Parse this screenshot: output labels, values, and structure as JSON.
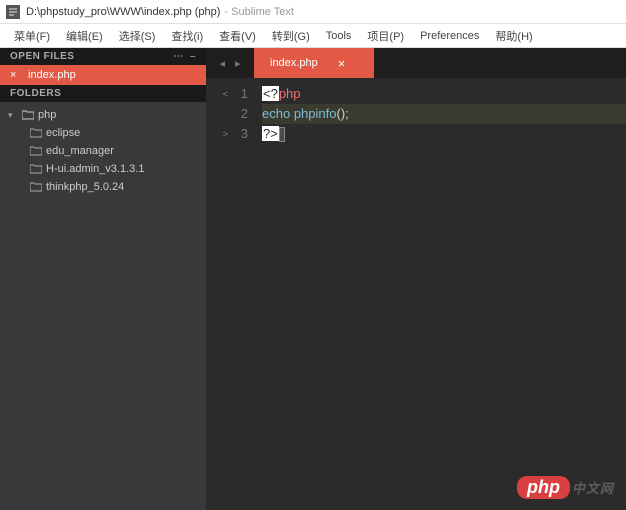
{
  "window": {
    "title_path": "D:\\phpstudy_pro\\WWW\\index.php (php)",
    "title_app": "- Sublime Text"
  },
  "menubar": [
    "菜单(F)",
    "编辑(E)",
    "选择(S)",
    "查找(i)",
    "查看(V)",
    "转到(G)",
    "Tools",
    "项目(P)",
    "Preferences",
    "帮助(H)"
  ],
  "sidebar": {
    "open_files_header": "OPEN FILES",
    "open_files": [
      {
        "name": "index.php"
      }
    ],
    "folders_header": "FOLDERS",
    "root": {
      "name": "php"
    },
    "children": [
      {
        "name": "eclipse"
      },
      {
        "name": "edu_manager"
      },
      {
        "name": "H-ui.admin_v3.1.3.1"
      },
      {
        "name": "thinkphp_5.0.24"
      }
    ]
  },
  "tabs": {
    "active": {
      "name": "index.php"
    }
  },
  "code": {
    "lines": [
      {
        "num": "1",
        "fold": "<",
        "tokens": [
          {
            "t": "<?",
            "c": "tag-bracket"
          },
          {
            "t": "php",
            "c": "kw-php"
          }
        ]
      },
      {
        "num": "2",
        "fold": "",
        "tokens": [
          {
            "t": "echo",
            "c": "kw-echo"
          },
          {
            "t": " ",
            "c": ""
          },
          {
            "t": "phpinfo",
            "c": "fn-name"
          },
          {
            "t": "();",
            "c": "punct"
          }
        ],
        "active": true
      },
      {
        "num": "3",
        "fold": ">",
        "tokens": [
          {
            "t": "?>",
            "c": "tag-bracket"
          }
        ],
        "cursor": true
      }
    ]
  },
  "watermark": {
    "pill": "php",
    "text": "中文网"
  }
}
